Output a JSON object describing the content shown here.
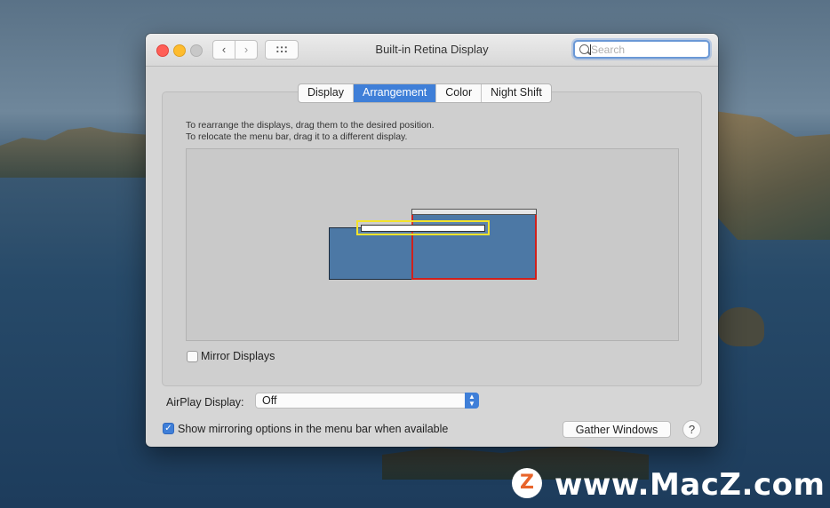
{
  "window": {
    "title": "Built-in Retina Display",
    "back_icon": "‹",
    "forward_icon": "›",
    "search_placeholder": "Search"
  },
  "tabs": [
    {
      "label": "Display",
      "active": false
    },
    {
      "label": "Arrangement",
      "active": true
    },
    {
      "label": "Color",
      "active": false
    },
    {
      "label": "Night Shift",
      "active": false
    }
  ],
  "arrangement": {
    "instruction_1": "To rearrange the displays, drag them to the desired position.",
    "instruction_2": "To relocate the menu bar, drag it to a different display."
  },
  "mirror_displays": {
    "label": "Mirror Displays",
    "checked": false
  },
  "airplay": {
    "label": "AirPlay Display:",
    "value": "Off"
  },
  "show_mirroring": {
    "label": "Show mirroring options in the menu bar when available",
    "checked": true
  },
  "buttons": {
    "gather_windows": "Gather Windows",
    "help": "?"
  },
  "watermark": {
    "logo_letter": "Z",
    "text": "www.MacZ.com"
  },
  "colors": {
    "accent": "#3f7fd8",
    "main_display_border": "#d0201c",
    "menubar_highlight": "#f4e32a",
    "display_fill": "#4c78a5"
  }
}
